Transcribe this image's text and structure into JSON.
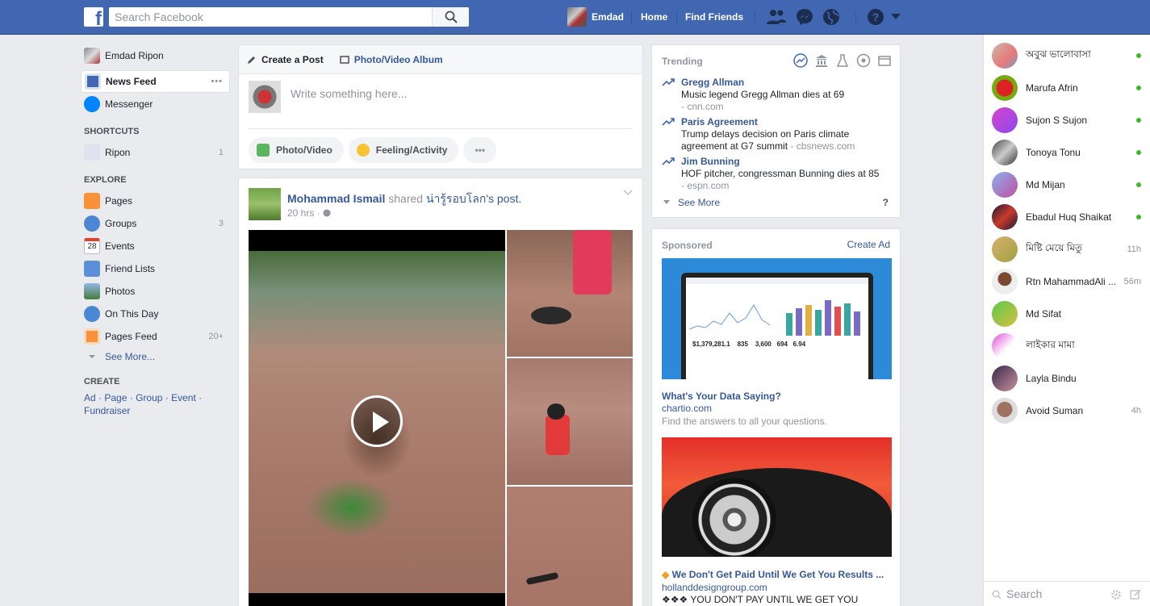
{
  "topbar": {
    "logo": "f",
    "search_placeholder": "Search Facebook",
    "user_name": "Emdad",
    "nav": [
      "Home",
      "Find Friends"
    ],
    "color": "#4267b2"
  },
  "left": {
    "profile": "Emdad Ripon",
    "main": [
      {
        "label": "News Feed",
        "icon": "news-feed-icon"
      },
      {
        "label": "Messenger",
        "icon": "messenger-icon"
      }
    ],
    "shortcuts_title": "SHORTCUTS",
    "shortcuts": [
      {
        "label": "Ripon",
        "count": "1"
      }
    ],
    "explore_title": "EXPLORE",
    "explore": [
      {
        "label": "Pages",
        "count": ""
      },
      {
        "label": "Groups",
        "count": "3"
      },
      {
        "label": "Events",
        "count": ""
      },
      {
        "label": "Friend Lists",
        "count": ""
      },
      {
        "label": "Photos",
        "count": ""
      },
      {
        "label": "On This Day",
        "count": ""
      },
      {
        "label": "Pages Feed",
        "count": "20+"
      }
    ],
    "see_more": "See More...",
    "create_title": "CREATE",
    "create_links": [
      "Ad",
      "Page",
      "Group",
      "Event",
      "Fundraiser"
    ],
    "events_day": "28"
  },
  "composer": {
    "tab_create": "Create a Post",
    "tab_album": "Photo/Video Album",
    "placeholder": "Write something here...",
    "btn_photo": "Photo/Video",
    "btn_feeling": "Feeling/Activity",
    "btn_more": "•••"
  },
  "post": {
    "author": "Mohammad Ismail",
    "shared": "shared",
    "page": "น่ารู้รอบโลก",
    "suffix": "'s post.",
    "time": "20 hrs ·"
  },
  "trending": {
    "title": "Trending",
    "items": [
      {
        "topic": "Gregg Allman",
        "desc": "Music legend Gregg Allman dies at 69",
        "source": "- cnn.com"
      },
      {
        "topic": "Paris Agreement",
        "desc": "Trump delays decision on Paris climate agreement at G7 summit",
        "source": "- cbsnews.com"
      },
      {
        "topic": "Jim Bunning",
        "desc": "HOF pitcher, congressman Bunning dies at 85",
        "source": "- espn.com"
      }
    ],
    "see_more": "See More",
    "help": "?"
  },
  "sponsored": {
    "title": "Sponsored",
    "create_ad": "Create Ad",
    "ad1": {
      "title": "What's Your Data Saying?",
      "domain": "chartio.com",
      "desc": "Find the answers to all your questions.",
      "stats": [
        "$1,379,281.1",
        "835",
        "3,600",
        "694",
        "6.94"
      ]
    },
    "ad2": {
      "title": "We Don't Get Paid Until We Get You Results ...",
      "domain": "hollanddesigngroup.com",
      "desc": "❖❖❖ YOU DON'T PAY UNTIL WE GET YOU"
    }
  },
  "chat": {
    "contacts": [
      {
        "name": "অবুঝ ভালোবাসা",
        "status": "online"
      },
      {
        "name": "Marufa Afrin",
        "status": "online"
      },
      {
        "name": "Sujon S Sujon",
        "status": "online"
      },
      {
        "name": "Tonoya Tonu",
        "status": "online"
      },
      {
        "name": "Md Mijan",
        "status": "online"
      },
      {
        "name": "Ebadul Huq Shaikat",
        "status": "online"
      },
      {
        "name": "মিষ্টি মেয়ে মিতু",
        "status": "11h"
      },
      {
        "name": "Rtn MahammadAli ...",
        "status": "56m"
      },
      {
        "name": "Md Sifat",
        "status": ""
      },
      {
        "name": "লাইকার মামা",
        "status": ""
      },
      {
        "name": "Layla Bindu",
        "status": ""
      },
      {
        "name": "Avoid Suman",
        "status": "4h"
      }
    ],
    "search_placeholder": "Search"
  }
}
